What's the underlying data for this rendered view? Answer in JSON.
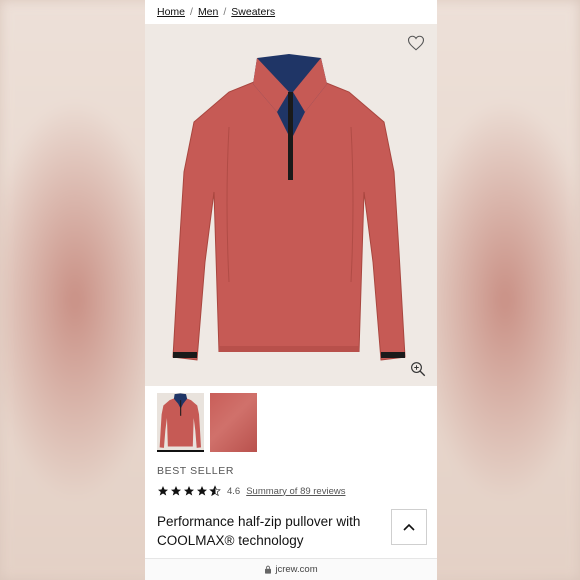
{
  "breadcrumb": {
    "items": [
      "Home",
      "Men",
      "Sweaters"
    ],
    "separator": "/"
  },
  "product": {
    "badge": "BEST SELLER",
    "rating_value": "4.6",
    "rating_stars": 4.6,
    "reviews_link": "Summary of 89 reviews",
    "title": "Performance half-zip pullover with COOLMAX® technology",
    "color_main": "#c65a55",
    "color_collar": "#1f3566"
  },
  "icons": {
    "wishlist": "heart-icon",
    "zoom": "zoom-in-icon",
    "collapse": "chevron-up-icon",
    "lock": "lock-icon"
  },
  "browser": {
    "url": "jcrew.com"
  }
}
